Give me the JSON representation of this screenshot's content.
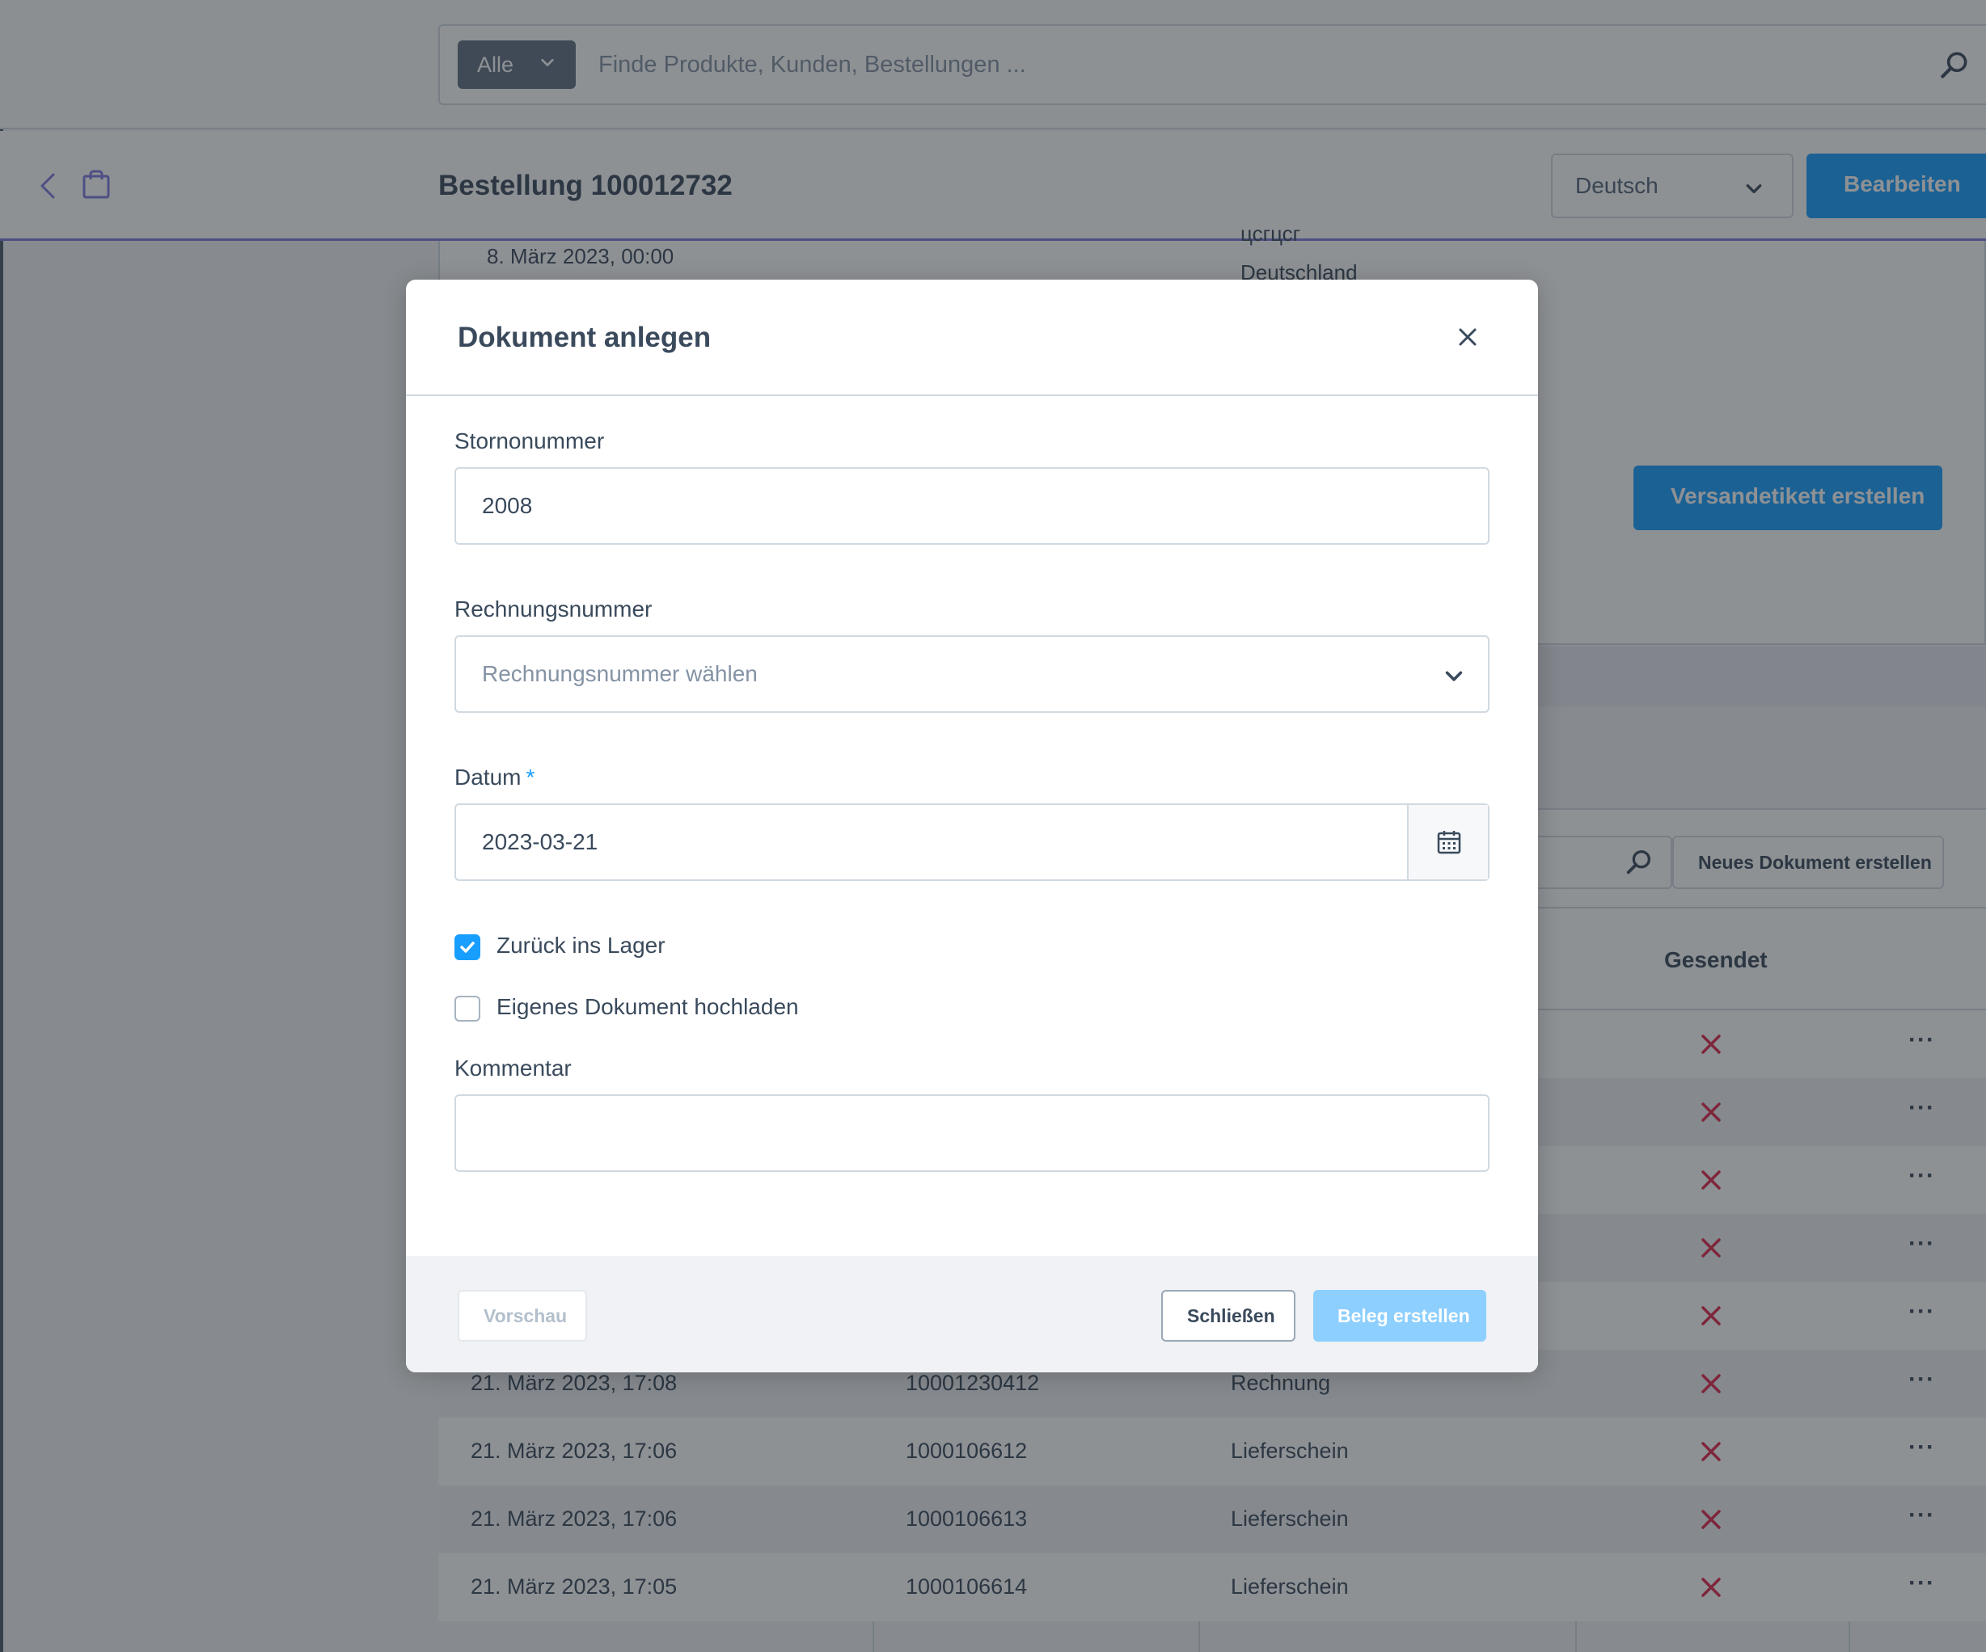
{
  "topbar": {
    "search_type": "Alle",
    "search_placeholder": "Finde Produkte, Kunden, Bestellungen ..."
  },
  "header": {
    "title": "Bestellung 100012732",
    "language": "Deutsch",
    "edit_label": "Bearbeiten"
  },
  "order_details": {
    "date": "8. März 2023, 00:00",
    "address_line_partial": "цсгцсг",
    "country": "Deutschland",
    "ship_label_button": "Versandetikett erstellen"
  },
  "documents": {
    "new_document_button": "Neues Dokument erstellen",
    "column_sent": "Gesendet",
    "rows": [
      {
        "date": "",
        "number": "",
        "type": ""
      },
      {
        "date": "",
        "number": "",
        "type": ""
      },
      {
        "date": "",
        "number": "",
        "type": ""
      },
      {
        "date": "",
        "number": "",
        "type": ""
      },
      {
        "date": "",
        "number": "",
        "type": ""
      },
      {
        "date": "21. März 2023, 17:08",
        "number": "10001230412",
        "type": "Rechnung"
      },
      {
        "date": "21. März 2023, 17:06",
        "number": "1000106612",
        "type": "Lieferschein"
      },
      {
        "date": "21. März 2023, 17:06",
        "number": "1000106613",
        "type": "Lieferschein"
      },
      {
        "date": "21. März 2023, 17:05",
        "number": "1000106614",
        "type": "Lieferschein"
      }
    ]
  },
  "modal": {
    "title": "Dokument anlegen",
    "storno_label": "Stornonummer",
    "storno_value": "2008",
    "invoice_label": "Rechnungsnummer",
    "invoice_placeholder": "Rechnungsnummer wählen",
    "date_label": "Datum",
    "date_required_marker": "*",
    "date_value": "2023-03-21",
    "return_to_stock_label": "Zurück ins Lager",
    "return_to_stock_checked": true,
    "upload_own_label": "Eigenes Dokument hochladen",
    "upload_own_checked": false,
    "comment_label": "Kommentar",
    "comment_value": "",
    "preview_label": "Vorschau",
    "close_label": "Schließen",
    "submit_label": "Beleg erstellen"
  },
  "colors": {
    "primary": "#189eff",
    "primary_disabled": "#8dcffe",
    "error_x": "#de294c",
    "accent_line": "#7e7adf"
  }
}
